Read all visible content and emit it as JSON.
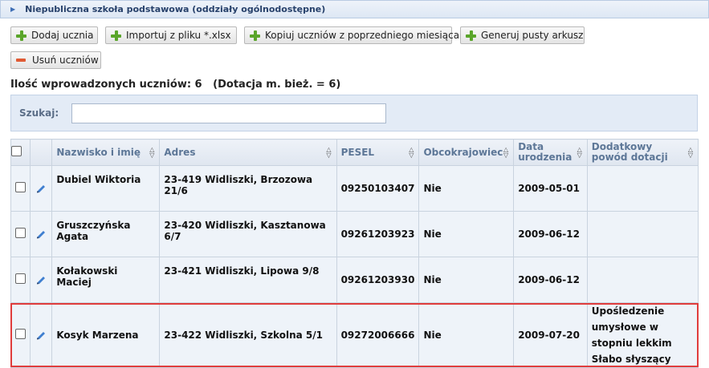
{
  "header": {
    "title": "Niepubliczna szkoła podstawowa (oddziały ogólnodostępne)"
  },
  "toolbar": {
    "add": "Dodaj ucznia",
    "import": "Importuj z pliku *.xlsx",
    "copy": "Kopiuj uczniów z poprzedniego miesiąca",
    "generate": "Generuj pusty arkusz",
    "remove": "Usuń uczniów"
  },
  "summary": "Ilość wprowadzonych uczniów: 6   (Dotacja m. bież. = 6)",
  "search": {
    "label": "Szukaj:",
    "value": ""
  },
  "table": {
    "headers": {
      "name": "Nazwisko i imię",
      "address": "Adres",
      "pesel": "PESEL",
      "foreigner": "Obcokrajowiec",
      "birth": "Data urodzenia",
      "reason": "Dodatkowy powód dotacji"
    },
    "rows": [
      {
        "name": "Dubiel Wiktoria",
        "address": "23-419 Widliszki, Brzozowa 21/6",
        "pesel": "09250103407",
        "foreigner": "Nie",
        "birth": "2009-05-01",
        "reason": ""
      },
      {
        "name": "Gruszczyńska Agata",
        "address": "23-420 Widliszki, Kasztanowa 6/7",
        "pesel": "09261203923",
        "foreigner": "Nie",
        "birth": "2009-06-12",
        "reason": ""
      },
      {
        "name": "Kołakowski Maciej",
        "address": "23-421 Widliszki, Lipowa 9/8",
        "pesel": "09261203930",
        "foreigner": "Nie",
        "birth": "2009-06-12",
        "reason": ""
      },
      {
        "name": "Kosyk Marzena",
        "address": "23-422 Widliszki, Szkolna 5/1",
        "pesel": "09272006666",
        "foreigner": "Nie",
        "birth": "2009-07-20",
        "reason": "Upośledzenie umysłowe w stopniu lekkim Słabo słyszący"
      }
    ]
  },
  "colors": {
    "highlight": "#e03c3c",
    "add_icon": "#5aa52a",
    "remove_icon": "#e05a33"
  }
}
